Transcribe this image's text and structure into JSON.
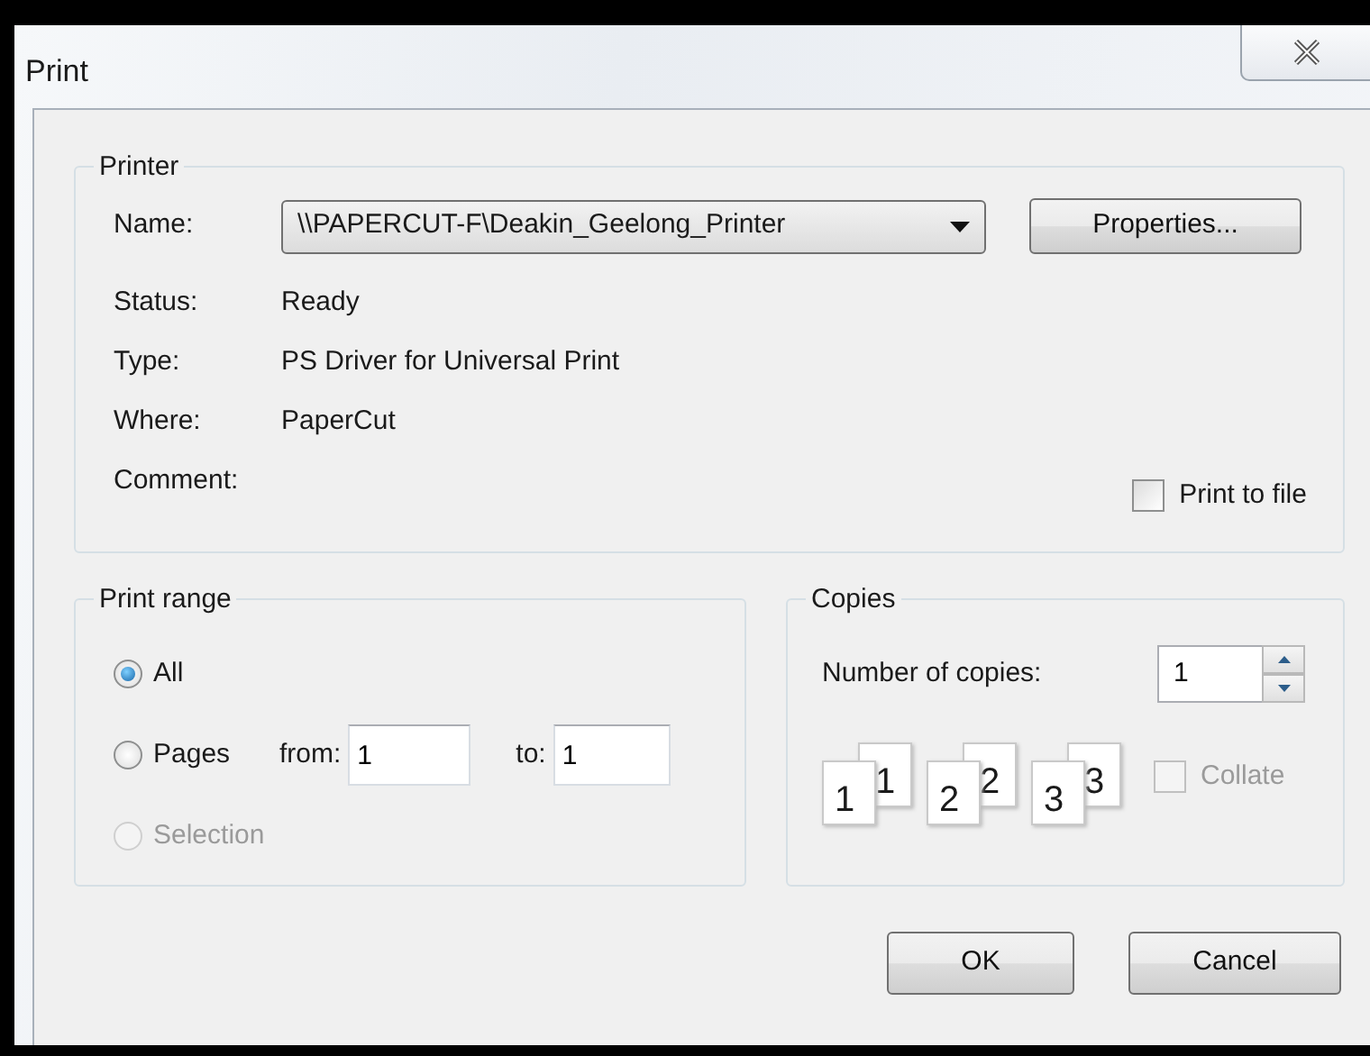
{
  "window": {
    "title": "Print"
  },
  "printer": {
    "legend": "Printer",
    "name_label": "Name:",
    "name_value": "\\\\PAPERCUT-F\\Deakin_Geelong_Printer",
    "properties_button": "Properties...",
    "info": [
      {
        "label": "Status:",
        "value": "Ready"
      },
      {
        "label": "Type:",
        "value": "PS Driver for Universal Print"
      },
      {
        "label": "Where:",
        "value": "PaperCut"
      },
      {
        "label": "Comment:"
      }
    ],
    "print_to_file": {
      "label": "Print to file",
      "checked": false
    }
  },
  "print_range": {
    "legend": "Print range",
    "options": [
      {
        "label": "All",
        "selected": true,
        "disabled": false
      },
      {
        "label": "Pages",
        "selected": false,
        "disabled": false
      },
      {
        "label": "Selection",
        "selected": false,
        "disabled": true
      }
    ],
    "from_label": "from:",
    "from_value": "1",
    "to_label": "to:",
    "to_value": "1"
  },
  "copies": {
    "legend": "Copies",
    "number_label": "Number of copies:",
    "number_value": "1",
    "collate_pages": [
      {
        "front": "1",
        "back": "1"
      },
      {
        "front": "2",
        "back": "2"
      },
      {
        "front": "3",
        "back": "3"
      }
    ],
    "collate": {
      "label": "Collate",
      "checked": false,
      "disabled": true
    }
  },
  "buttons": [
    "OK",
    "Cancel"
  ]
}
